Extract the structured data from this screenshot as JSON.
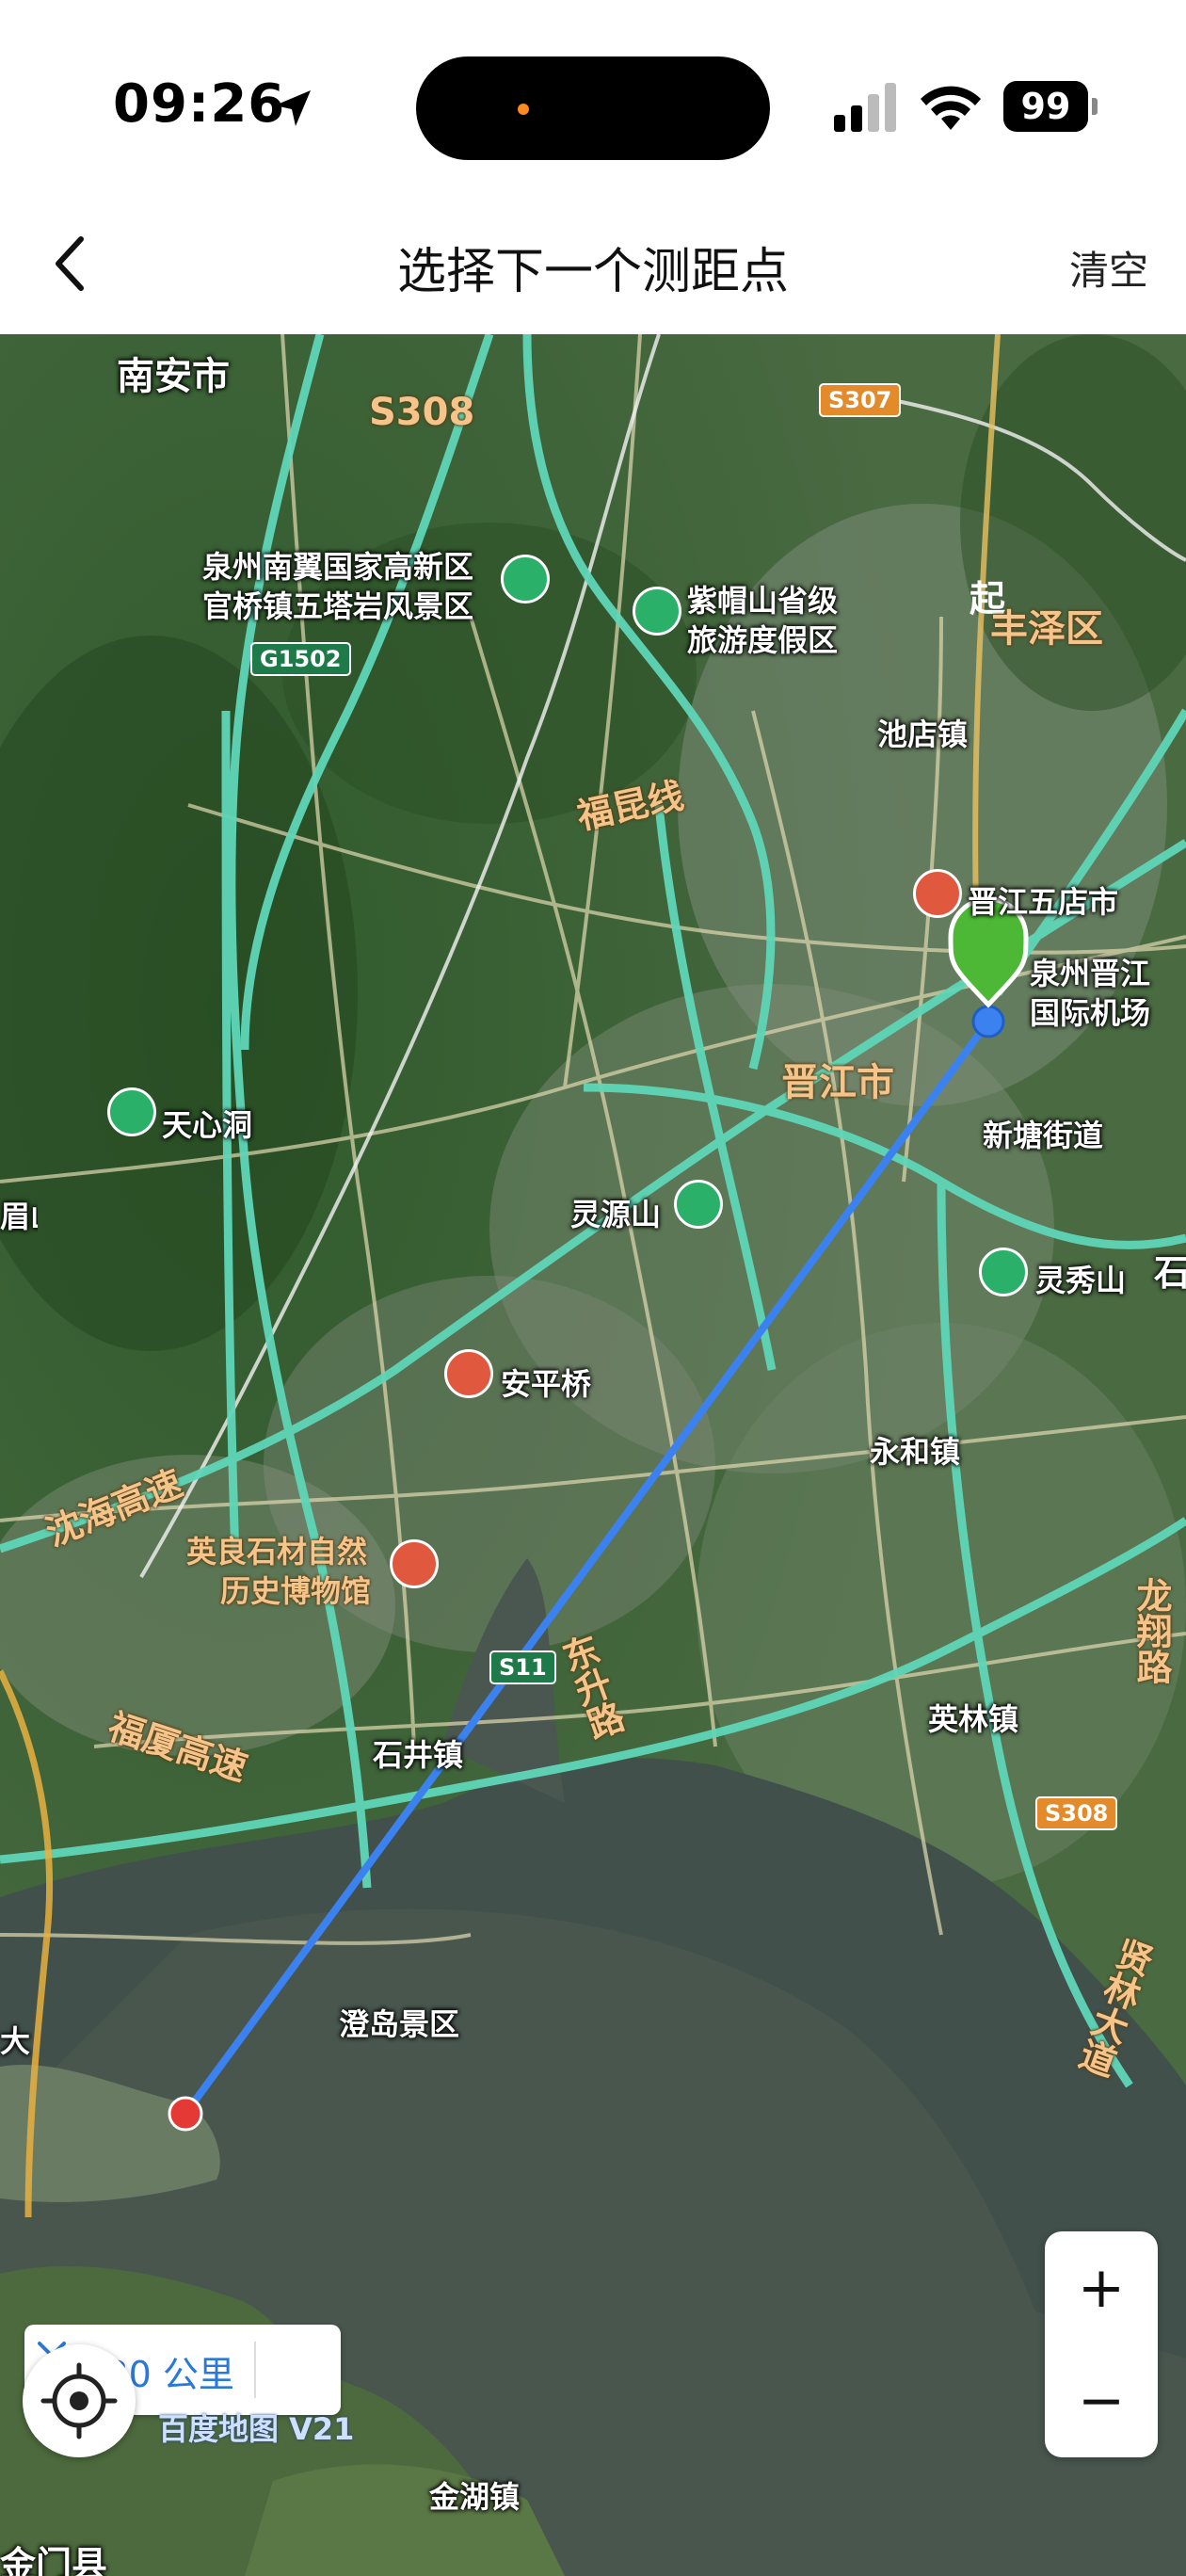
{
  "status_bar": {
    "time": "09:26",
    "battery": "99"
  },
  "nav": {
    "title": "选择下一个测距点",
    "clear_label": "清空"
  },
  "map": {
    "places": [
      {
        "id": "nanan",
        "text": "南安市"
      },
      {
        "id": "nanyi",
        "text": "泉州南翼国家高新区"
      },
      {
        "id": "guanqiao",
        "text": "官桥镇五塔岩风景区"
      },
      {
        "id": "zimao",
        "text": "紫帽山省级"
      },
      {
        "id": "zimao2",
        "text": "旅游度假区"
      },
      {
        "id": "fengze",
        "text": "丰泽区"
      },
      {
        "id": "chidian",
        "text": "池店镇"
      },
      {
        "id": "wudian",
        "text": "晋江五店市"
      },
      {
        "id": "airport",
        "text": "泉州晋江"
      },
      {
        "id": "airport2",
        "text": "国际机场"
      },
      {
        "id": "jinjiang",
        "text": "晋江市"
      },
      {
        "id": "xintang",
        "text": "新塘街道"
      },
      {
        "id": "tianxin",
        "text": "天心洞"
      },
      {
        "id": "lingyuan",
        "text": "灵源山"
      },
      {
        "id": "lingxiu",
        "text": "灵秀山"
      },
      {
        "id": "anping",
        "text": "安平桥"
      },
      {
        "id": "yonghe",
        "text": "永和镇"
      },
      {
        "id": "yingliang",
        "text": "英良石材自然"
      },
      {
        "id": "yingliang2",
        "text": "历史博物馆"
      },
      {
        "id": "shijing",
        "text": "石井镇"
      },
      {
        "id": "yinglin",
        "text": "英林镇"
      },
      {
        "id": "dengdao",
        "text": "澄岛景区"
      },
      {
        "id": "jinhu",
        "text": "金湖镇"
      },
      {
        "id": "jinmen",
        "text": "金门县"
      },
      {
        "id": "leftmei",
        "text": "眉山"
      },
      {
        "id": "leftda",
        "text": "大"
      },
      {
        "id": "rightshi",
        "text": "石"
      }
    ],
    "roads": [
      {
        "id": "s308a",
        "text": "S308"
      },
      {
        "id": "fukun",
        "text": "福昆线"
      },
      {
        "id": "shenhai",
        "text": "沈海高速"
      },
      {
        "id": "fusha",
        "text": "福厦高速"
      },
      {
        "id": "dongsheng",
        "text": "东升路"
      },
      {
        "id": "longxiang",
        "text": "龙翔路"
      },
      {
        "id": "xianlin",
        "text": "贤林大道"
      }
    ],
    "shields": [
      {
        "id": "s307",
        "text": "S307"
      },
      {
        "id": "g1502",
        "text": "G1502"
      },
      {
        "id": "s11",
        "text": "S11"
      },
      {
        "id": "s308b",
        "text": "S308"
      }
    ],
    "start_marker": "起",
    "distance": "36.30 公里",
    "brand": "百度地图 V21",
    "zoom_in": "+",
    "zoom_out": "−"
  },
  "icons": {
    "location_arrow": "location-arrow-icon",
    "back": "back-chevron-icon",
    "close": "close-icon",
    "locate": "locate-icon",
    "scenic": "tree-icon",
    "museum": "museum-icon"
  },
  "colors": {
    "measure_line": "#3b82f0",
    "start_pin": "#4db836",
    "end_pin": "#e53935",
    "distance_text": "#2979d8"
  }
}
